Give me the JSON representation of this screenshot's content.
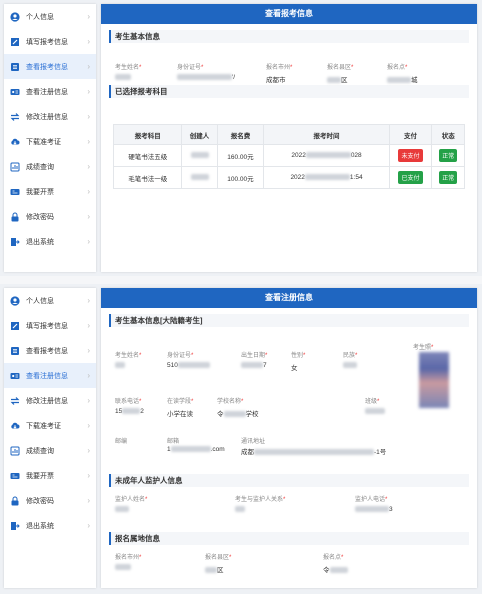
{
  "sidebar_items": [
    {
      "label": "个人信息",
      "icon": "user-icon"
    },
    {
      "label": "填写报考信息",
      "icon": "edit-icon"
    },
    {
      "label": "查看报考信息",
      "icon": "list-icon"
    },
    {
      "label": "查看注册信息",
      "icon": "id-card-icon"
    },
    {
      "label": "修改注册信息",
      "icon": "swap-icon"
    },
    {
      "label": "下载准考证",
      "icon": "cloud-download-icon"
    },
    {
      "label": "成绩查询",
      "icon": "grade-icon"
    },
    {
      "label": "我要开票",
      "icon": "invoice-icon"
    },
    {
      "label": "修改密码",
      "icon": "lock-icon"
    },
    {
      "label": "退出系统",
      "icon": "logout-icon"
    }
  ],
  "top": {
    "active_index": 2,
    "title": "查看报考信息",
    "section_basic": "考生基本信息",
    "fields": {
      "name": "考生姓名",
      "id": "身份证号",
      "city": "报名市州",
      "county": "报名县区",
      "site": "报名点"
    },
    "values": {
      "id_tail": "'/",
      "city": "成都市",
      "county": "区",
      "site": "城"
    },
    "section_subjects": "已选择报考科目",
    "table_headers": [
      "报考科目",
      "创建人",
      "报名费",
      "报考时间",
      "支付",
      "状态"
    ],
    "rows": [
      {
        "subject": "硬笔书法五级",
        "fee": "160.00元",
        "time_head": "2022",
        "time_tail": "028",
        "pay": "未支付",
        "status": "正常"
      },
      {
        "subject": "毛笔书法一级",
        "fee": "100.00元",
        "time_head": "2022",
        "time_tail": "1:54",
        "pay": "已支付",
        "status": "正常"
      }
    ]
  },
  "bottom": {
    "active_index": 3,
    "title": "查看注册信息",
    "section_basic": "考生基本信息[大陆籍考生]",
    "fields": {
      "name": "考生姓名",
      "id": "身份证号",
      "birth": "出生日期",
      "gender": "性别",
      "ethnic": "民族",
      "photo": "考生照",
      "phone": "联系电话",
      "school_level": "在读学段",
      "school": "学校名称",
      "class": "班级",
      "postcode": "邮编",
      "email": "邮箱",
      "address": "通讯地址"
    },
    "values": {
      "id_head": "510",
      "birth_tail": "7",
      "gender": "女",
      "phone_head": "15",
      "phone_tail": "2",
      "school_level": "小学在读",
      "school_head": "令",
      "school_tail": "学校",
      "email_head": "1",
      "email_tail": ".com",
      "address_head": "成都",
      "address_tail": "-1号"
    },
    "section_guardian": "未成年人监护人信息",
    "guardian_fields": {
      "name": "监护人姓名",
      "relation": "考生与监护人关系",
      "phone": "监护人电话"
    },
    "guardian_values": {
      "phone_tail": "3"
    },
    "section_area": "报名属地信息",
    "area_fields": {
      "city": "报名市州",
      "county": "报名县区",
      "site": "报名点"
    },
    "area_values": {
      "county": "区",
      "site": "令"
    }
  },
  "colors": {
    "header_blue": "#1f66c1",
    "unpaid_red": "#e83a3a",
    "paid_green": "#24a148"
  }
}
